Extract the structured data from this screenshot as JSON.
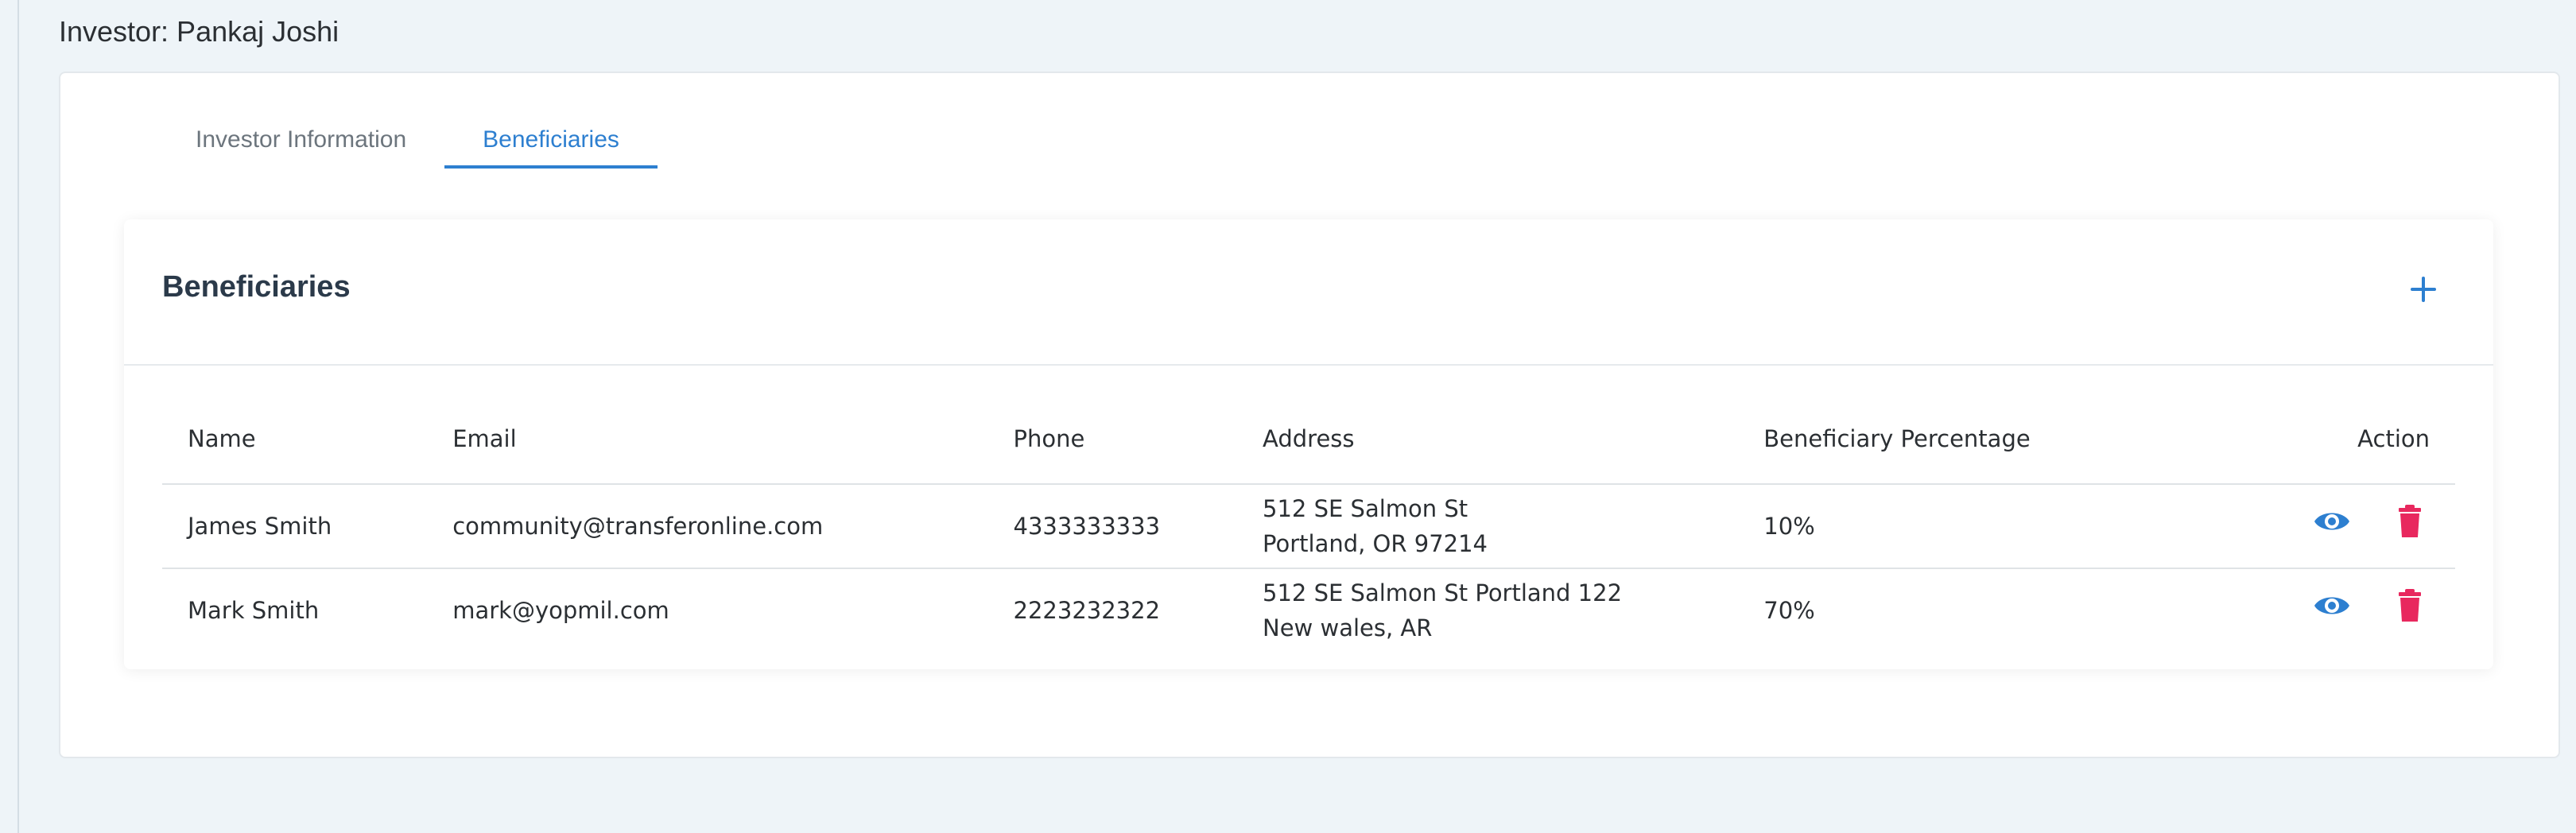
{
  "page": {
    "title": "Investor: Pankaj Joshi"
  },
  "tabs": [
    {
      "label": "Investor Information",
      "active": false
    },
    {
      "label": "Beneficiaries",
      "active": true
    }
  ],
  "card": {
    "title": "Beneficiaries",
    "add_icon": "plus-icon"
  },
  "table": {
    "headers": [
      "Name",
      "Email",
      "Phone",
      "Address",
      "Beneficiary Percentage",
      "Action"
    ],
    "rows": [
      {
        "name": "James Smith",
        "email": "community@transferonline.com",
        "phone": "4333333333",
        "address_line1": "512 SE Salmon St",
        "address_line2": "Portland, OR 97214",
        "percentage": "10%"
      },
      {
        "name": "Mark Smith",
        "email": "mark@yopmil.com",
        "phone": "2223232322",
        "address_line1": "512 SE Salmon St Portland 122",
        "address_line2": "New wales, AR",
        "percentage": "70%"
      }
    ],
    "action_icons": [
      "eye-icon",
      "trash-icon"
    ]
  },
  "colors": {
    "accent": "#2d7fd0",
    "danger": "#e8285e",
    "background": "#eef4f8"
  }
}
